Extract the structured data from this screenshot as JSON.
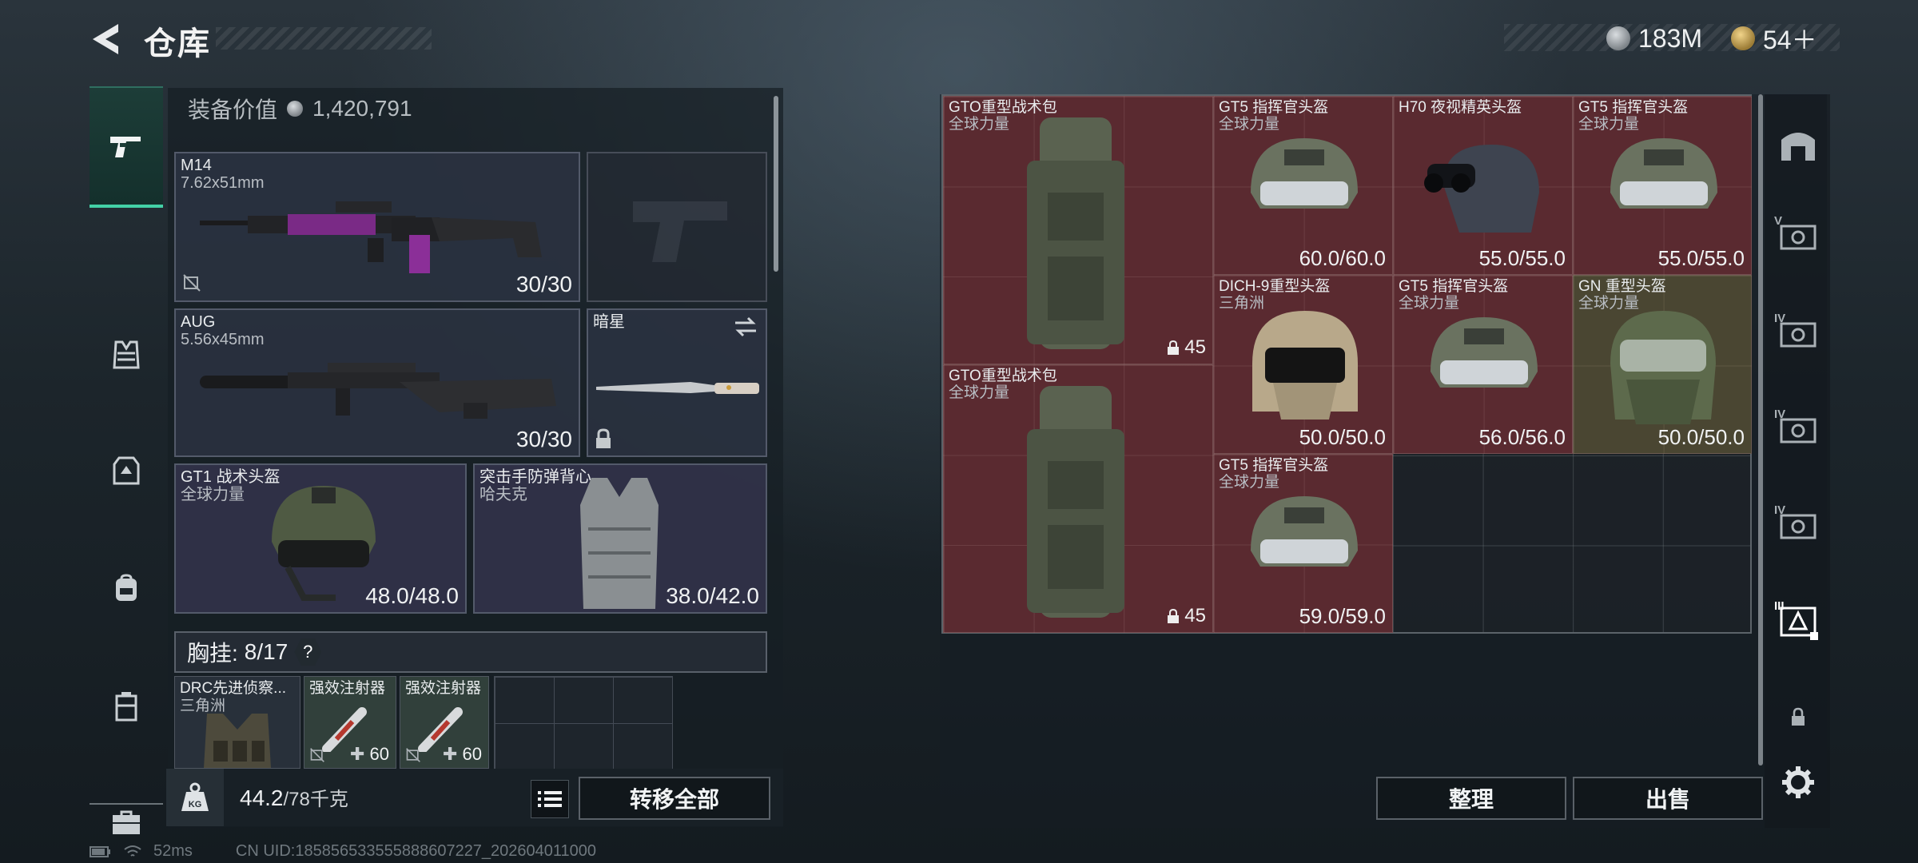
{
  "header": {
    "title": "仓库",
    "currencies": [
      {
        "icon": "silver-coin-icon",
        "value": "183M"
      },
      {
        "icon": "gold-coin-icon",
        "value": "54＋"
      }
    ]
  },
  "left_rail": {
    "items": [
      {
        "name": "weapons-category",
        "icon": "pistol-icon",
        "active": true
      },
      {
        "name": "vest-category",
        "icon": "chest-rig-icon"
      },
      {
        "name": "armor-category",
        "icon": "body-armor-icon"
      },
      {
        "name": "backpack-category",
        "icon": "backpack-icon"
      },
      {
        "name": "container-category",
        "icon": "case-icon"
      },
      {
        "name": "toolbox-category",
        "icon": "toolbox-icon"
      }
    ]
  },
  "equipment": {
    "value_label": "装备价值",
    "value": "1,420,791",
    "primary_weapon": {
      "name": "M14",
      "caliber": "7.62x51mm",
      "ammo": "30/30"
    },
    "secondary_weapon": {
      "name": "AUG",
      "caliber": "5.56x45mm",
      "ammo": "30/30"
    },
    "melee": {
      "name": "暗星"
    },
    "helmet": {
      "name": "GT1 战术头盔",
      "brand": "全球力量",
      "durability": "48.0/48.0"
    },
    "armor": {
      "name": "突击手防弹背心",
      "brand": "哈夫克",
      "durability": "38.0/42.0"
    },
    "chest_rig": {
      "label": "胸挂:",
      "count": "8/17",
      "help": "?"
    },
    "rig_items": [
      {
        "name": "DRC先进侦察...",
        "brand": "三角洲"
      },
      {
        "name": "强效注射器",
        "amount": "60"
      },
      {
        "name": "强效注射器",
        "amount": "60"
      }
    ],
    "weight": {
      "value": "44.2",
      "capacity": "/78千克",
      "unit_icon": "KG"
    },
    "transfer_all": "转移全部"
  },
  "storage": {
    "items": [
      {
        "name": "GTO重型战术包",
        "brand": "全球力量",
        "capacity": "45"
      },
      {
        "name": "GT5 指挥官头盔",
        "brand": "全球力量",
        "durability": "60.0/60.0"
      },
      {
        "name": "H70 夜视精英头盔",
        "brand": "",
        "durability": "55.0/55.0"
      },
      {
        "name": "GT5 指挥官头盔",
        "brand": "全球力量",
        "durability": "55.0/55.0"
      },
      {
        "name": "DICH-9重型头盔",
        "brand": "三角洲",
        "durability": "50.0/50.0"
      },
      {
        "name": "GT5 指挥官头盔",
        "brand": "全球力量",
        "durability": "56.0/56.0"
      },
      {
        "name": "GN 重型头盔",
        "brand": "全球力量",
        "durability": "50.0/50.0"
      },
      {
        "name": "GTO重型战术包",
        "brand": "全球力量",
        "capacity": "45"
      },
      {
        "name": "GT5 指挥官头盔",
        "brand": "全球力量",
        "durability": "59.0/59.0"
      }
    ],
    "sort_button": "整理",
    "sell_button": "出售"
  },
  "right_rail": {
    "tier_labels": [
      "V",
      "IV",
      "IV",
      "IV",
      "III"
    ]
  },
  "status": {
    "ping": "52ms",
    "uid": "CN UID:1858565335558886072​27_202604011000"
  }
}
